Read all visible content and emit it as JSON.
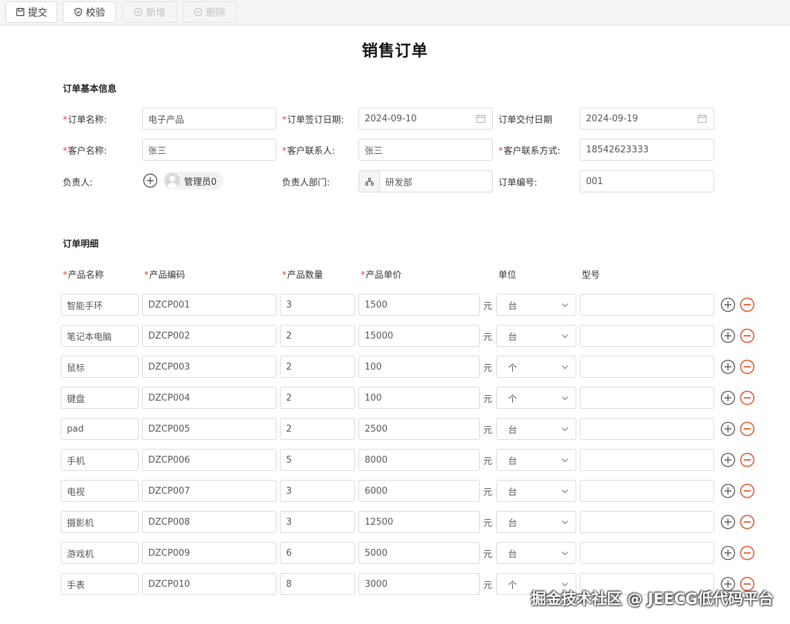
{
  "toolbar": {
    "submit_label": "提交",
    "validate_label": "校验",
    "add_label": "新增",
    "delete_label": "删除"
  },
  "title": "销售订单",
  "basic_section": {
    "title": "订单基本信息",
    "order_name_label": "订单名称:",
    "order_name_value": "电子产品",
    "sign_date_label": "订单签订日期:",
    "sign_date_value": "2024-09-10",
    "delivery_date_label": "订单交付日期",
    "delivery_date_value": "2024-09-19",
    "customer_name_label": "客户名称:",
    "customer_name_value": "张三",
    "customer_contact_label": "客户联系人:",
    "customer_contact_value": "张三",
    "contact_method_label": "客户联系方式:",
    "contact_method_value": "18542623333",
    "owner_label": "负责人:",
    "owner_value": "管理员0",
    "owner_dept_label": "负责人部门:",
    "owner_dept_value": "研发部",
    "order_no_label": "订单编号:",
    "order_no_value": "001"
  },
  "detail_section": {
    "title": "订单明细",
    "headers": {
      "name": "产品名称",
      "code": "产品编码",
      "qty": "产品数量",
      "price": "产品单价",
      "unit": "单位",
      "model": "型号"
    },
    "currency_suffix": "元",
    "rows": [
      {
        "name": "智能手环",
        "code": "DZCP001",
        "qty": "3",
        "price": "1500",
        "unit": "台",
        "model": ""
      },
      {
        "name": "笔记本电脑",
        "code": "DZCP002",
        "qty": "2",
        "price": "15000",
        "unit": "台",
        "model": ""
      },
      {
        "name": "鼠标",
        "code": "DZCP003",
        "qty": "2",
        "price": "100",
        "unit": "个",
        "model": ""
      },
      {
        "name": "键盘",
        "code": "DZCP004",
        "qty": "2",
        "price": "100",
        "unit": "个",
        "model": ""
      },
      {
        "name": "pad",
        "code": "DZCP005",
        "qty": "2",
        "price": "2500",
        "unit": "台",
        "model": ""
      },
      {
        "name": "手机",
        "code": "DZCP006",
        "qty": "5",
        "price": "8000",
        "unit": "台",
        "model": ""
      },
      {
        "name": "电视",
        "code": "DZCP007",
        "qty": "3",
        "price": "6000",
        "unit": "台",
        "model": ""
      },
      {
        "name": "摄影机",
        "code": "DZCP008",
        "qty": "3",
        "price": "12500",
        "unit": "台",
        "model": ""
      },
      {
        "name": "游戏机",
        "code": "DZCP009",
        "qty": "6",
        "price": "5000",
        "unit": "台",
        "model": ""
      },
      {
        "name": "手表",
        "code": "DZCP010",
        "qty": "8",
        "price": "3000",
        "unit": "个",
        "model": ""
      }
    ]
  },
  "watermark": "掘金技术社区 @ JEECG低代码平台",
  "colors": {
    "required": "#e04040",
    "remove_icon": "#e0542c",
    "add_icon": "#555555",
    "border": "#d9d9d9"
  }
}
